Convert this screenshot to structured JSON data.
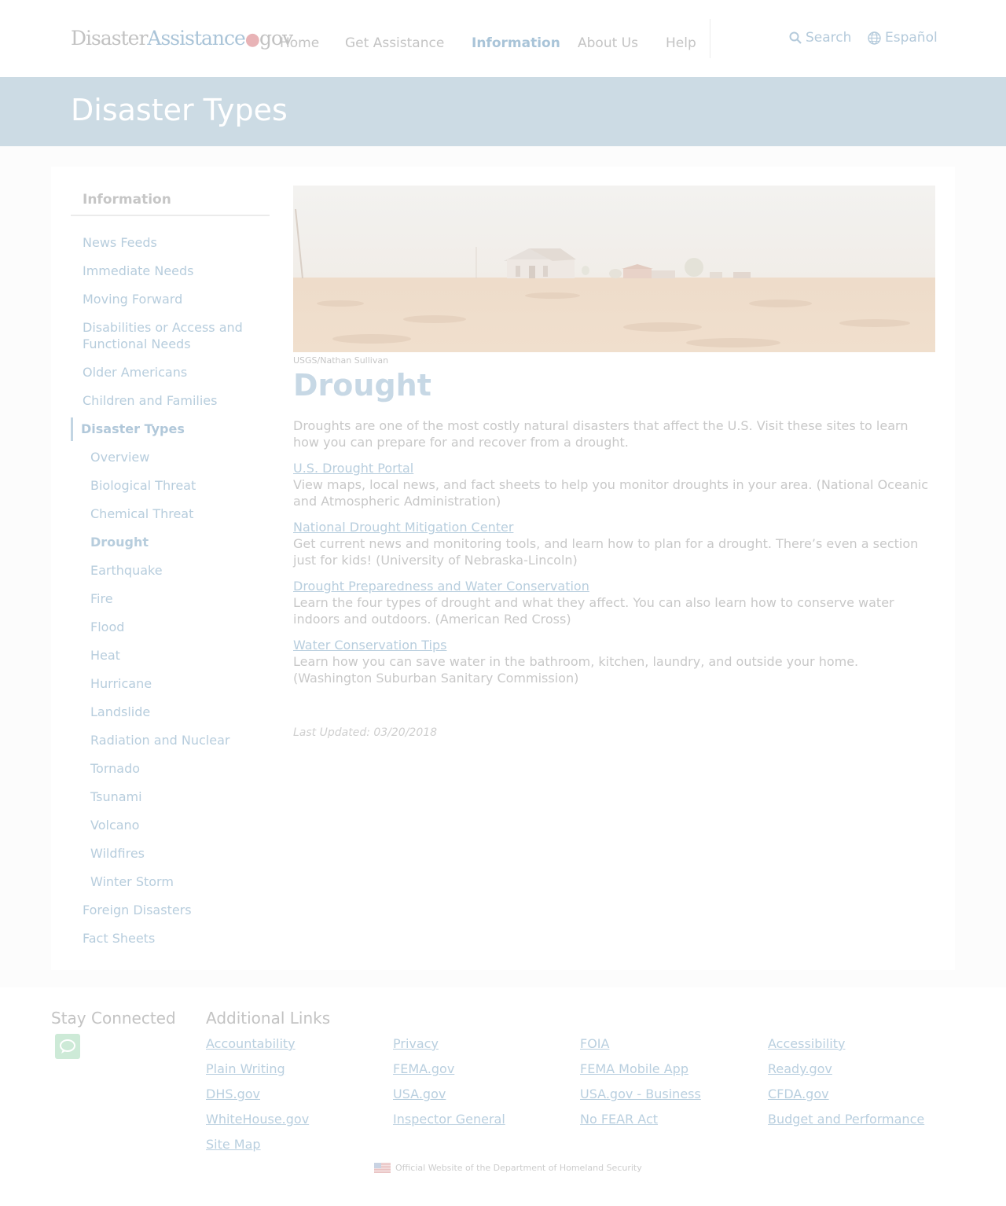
{
  "header": {
    "logo": {
      "part1": "Disaster",
      "part2": "Assistance",
      "dot": "●",
      "part3": "gov"
    },
    "nav": [
      {
        "label": "Home"
      },
      {
        "label": "Get Assistance"
      },
      {
        "label": "Information"
      },
      {
        "label": "About Us"
      },
      {
        "label": "Help"
      }
    ],
    "search_label": "Search",
    "language_label": "Español",
    "icons": [
      "search-icon",
      "globe-icon"
    ]
  },
  "banner": {
    "title": "Disaster Types"
  },
  "sidebar": {
    "title": "Information",
    "items": [
      {
        "label": "News Feeds"
      },
      {
        "label": "Immediate Needs"
      },
      {
        "label": "Moving Forward"
      },
      {
        "label": "Disabilities or Access and Functional Needs"
      },
      {
        "label": "Older Americans"
      },
      {
        "label": "Children and Families"
      },
      {
        "label": "Disaster Types"
      },
      {
        "label": "Foreign Disasters"
      },
      {
        "label": "Fact Sheets"
      }
    ],
    "subitems": [
      {
        "label": "Overview"
      },
      {
        "label": "Biological Threat"
      },
      {
        "label": "Chemical Threat"
      },
      {
        "label": "Drought"
      },
      {
        "label": "Earthquake"
      },
      {
        "label": "Fire"
      },
      {
        "label": "Flood"
      },
      {
        "label": "Heat"
      },
      {
        "label": "Hurricane"
      },
      {
        "label": "Landslide"
      },
      {
        "label": "Radiation and Nuclear"
      },
      {
        "label": "Tornado"
      },
      {
        "label": "Tsunami"
      },
      {
        "label": "Volcano"
      },
      {
        "label": "Wildfires"
      },
      {
        "label": "Winter Storm"
      }
    ]
  },
  "main": {
    "image_caption": "USGS/Nathan Sullivan",
    "title": "Drought",
    "intro": "Droughts are one of the most costly natural disasters that affect the U.S. Visit these sites to learn how you can prepare for and recover from a drought.",
    "resources": [
      {
        "link": "U.S. Drought Portal",
        "description": "View maps, local news, and fact sheets to help you monitor droughts in your area. (National Oceanic and Atmospheric Administration)"
      },
      {
        "link": "National Drought Mitigation Center",
        "description": "Get current news and monitoring tools, and learn how to plan for a drought. There’s even a section just for kids! (University of Nebraska-Lincoln)"
      },
      {
        "link": "Drought Preparedness and Water Conservation",
        "description": "Learn the four types of drought and what they affect. You can also learn how to conserve water indoors and outdoors. (American Red Cross)"
      },
      {
        "link": "Water Conservation Tips",
        "description": "Learn how you can save water in the bathroom, kitchen, laundry, and outside your home. (Washington Suburban Sanitary Commission)"
      }
    ],
    "last_updated": "Last Updated: 03/20/2018"
  },
  "footer": {
    "stay_connected": "Stay Connected",
    "additional_links_title": "Additional Links",
    "links": [
      "Accountability",
      "Privacy",
      "FOIA",
      "Accessibility",
      "Plain Writing",
      "FEMA.gov",
      "FEMA Mobile App",
      "Ready.gov",
      "DHS.gov",
      "USA.gov",
      "USA.gov - Business",
      "CFDA.gov",
      "WhiteHouse.gov",
      "Inspector General",
      "No FEAR Act",
      "Budget and Performance",
      "Site Map"
    ],
    "official": "Official Website of the Department of Homeland Security",
    "icons": [
      "chat-icon",
      "us-flag-icon"
    ]
  },
  "colors": {
    "banner": "#ccdbe4",
    "link": "#b7cddd",
    "text": "#c8c8c8"
  }
}
